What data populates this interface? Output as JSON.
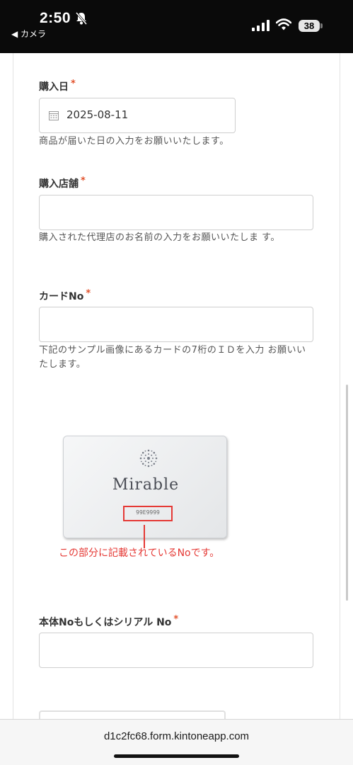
{
  "status_bar": {
    "time": "2:50",
    "back_app": "◀ カメラ",
    "battery": "38"
  },
  "form": {
    "purchase_date": {
      "label": "購入日",
      "required_mark": "*",
      "value": "2025-08-11",
      "help": "商品が届いた日の入力をお願いいたします。"
    },
    "purchase_store": {
      "label": "購入店舗",
      "required_mark": "*",
      "value": "",
      "help": "購入された代理店のお名前の入力をお願いいたしま す。"
    },
    "card_no": {
      "label": "カードNo",
      "required_mark": "*",
      "value": "",
      "help": "下記のサンプル画像にあるカードの7桁のＩＤを入力 お願いいたします。"
    },
    "sample_image": {
      "brand": "Mirable",
      "serial": "99E9999",
      "callout": "この部分に記載されているNoです。"
    },
    "body_serial_no": {
      "label": "本体Noもしくはシリアル No",
      "required_mark": "*",
      "value": ""
    }
  },
  "browser": {
    "url": "d1c2fc68.form.kintoneapp.com"
  },
  "colors": {
    "required": "#e2532d",
    "callout": "#e53935",
    "statusbar": "#0a0a0a"
  }
}
